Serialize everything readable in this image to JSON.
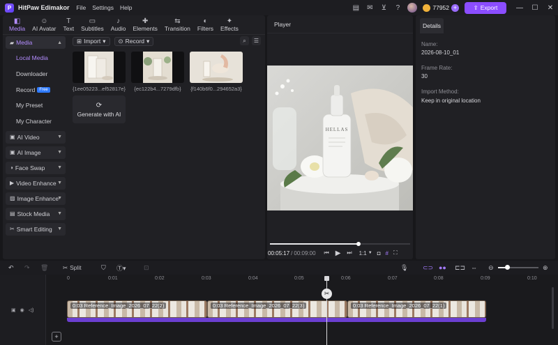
{
  "app": {
    "title": "HitPaw Edimakor",
    "logo_letter": "P",
    "menu": [
      "File",
      "Settings",
      "Help"
    ],
    "credits": "77952",
    "export_label": "Export"
  },
  "tabs": [
    {
      "label": "Media",
      "icon": "◧"
    },
    {
      "label": "AI Avatar",
      "icon": "☺"
    },
    {
      "label": "Text",
      "icon": "T"
    },
    {
      "label": "Subtitles",
      "icon": "▭"
    },
    {
      "label": "Audio",
      "icon": "♪"
    },
    {
      "label": "Elements",
      "icon": "✚"
    },
    {
      "label": "Transition",
      "icon": "⇆"
    },
    {
      "label": "Filters",
      "icon": "◐"
    },
    {
      "label": "Effects",
      "icon": "✦"
    }
  ],
  "sidebar": {
    "media_head": "Media",
    "sub_items": [
      "Local Media",
      "Downloader",
      "Record",
      "My Preset",
      "My Character"
    ],
    "free_badge": "Free",
    "sections": [
      "AI Video",
      "AI Image",
      "Face Swap",
      "Video Enhance",
      "Image Enhance",
      "Stock Media",
      "Smart Editing"
    ]
  },
  "media": {
    "import_label": "Import",
    "record_label": "Record",
    "thumbnails": [
      {
        "name": "{1ee05223...ef52817e}"
      },
      {
        "name": "{ec122b4...7279dfb}"
      },
      {
        "name": "{f140b6f0...294652a3}"
      }
    ],
    "generate_label": "Generate with AI"
  },
  "player": {
    "title": "Player",
    "current_time": "00:05:17",
    "separator": "/",
    "total_time": "00:09:00",
    "progress": 0.63,
    "speed": "1:1",
    "bottle_brand": "HELLAS"
  },
  "details": {
    "tab": "Details",
    "name_label": "Name:",
    "name_value": "2026-08-10_01",
    "frame_rate_label": "Frame Rate:",
    "frame_rate_value": "30",
    "import_method_label": "Import Method:",
    "import_method_value": "Keep in original location"
  },
  "timeline": {
    "split_label": "Split",
    "ticks": [
      "0",
      "0:01",
      "0:02",
      "0:03",
      "0:04",
      "0:05",
      "0:06",
      "0:07",
      "0:08",
      "0:09",
      "0:10"
    ],
    "clips": [
      {
        "label": "0:03 Reference_Image_2026_07_22(2)"
      },
      {
        "label": "0:03 Reference_Image_2026_07_22(3)"
      },
      {
        "label": "0:03 Reference_Image_2026_07_22(1)"
      }
    ],
    "zoom_level": 0.2
  }
}
